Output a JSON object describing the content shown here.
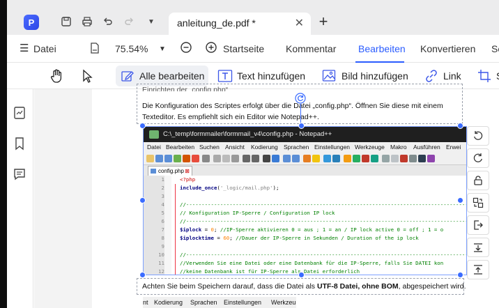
{
  "titlebar": {
    "tab_title": "anleitung_de.pdf *",
    "tab_close": "✕",
    "new_tab": "+"
  },
  "menubar": {
    "file": "Datei",
    "zoom": "75.54%",
    "items": [
      "Startseite",
      "Kommentar",
      "Bearbeiten",
      "Konvertieren",
      "Se"
    ],
    "active": "Bearbeiten"
  },
  "toolbar": {
    "edit_all": "Alle bearbeiten",
    "add_text": "Text hinzufügen",
    "add_image": "Bild hinzufügen",
    "link": "Link",
    "more": "S"
  },
  "document": {
    "heading_partial": "Einrichten der „config.php“",
    "para1_line1": "Die Konfiguration des Scriptes erfolgt über die Datei „config.php“. Öffnen Sie diese mit einem",
    "para1_line2": "Texteditor. Es empfiehlt sich ein Editor wie Notepad++.",
    "para2_prefix": "Achten Sie beim Speichern darauf, dass die Datei als ",
    "para2_bold": "UTF-8 Datei, ohne BOM",
    "para2_suffix": ", abgespeichert wird."
  },
  "notepad": {
    "title": "C:\\_temp\\formmailer\\formmail_v4\\config.php - Notepad++",
    "menu": [
      "Datei",
      "Bearbeiten",
      "Suchen",
      "Ansicht",
      "Kodierung",
      "Sprachen",
      "Einstellungen",
      "Werkzeuge",
      "Makro",
      "Ausführen",
      "Erwei"
    ],
    "tab": "config.php",
    "lines": [
      {
        "n": "1",
        "t": "<?php"
      },
      {
        "n": "2",
        "t": "include_once('_logic/mail.php');"
      },
      {
        "n": "3",
        "t": ""
      },
      {
        "n": "4",
        "t": "//--------------------------------------------------------------------------------------------"
      },
      {
        "n": "5",
        "t": "// Konfiguration IP-Sperre / Configuration IP lock"
      },
      {
        "n": "6",
        "t": "//--------------------------------------------------------------------------------------------"
      },
      {
        "n": "7",
        "t": "$iplock = 0;  //IP-Sperre aktivieren 0 = aus ; 1 = an / IP lock active 0 = off ; 1 = o"
      },
      {
        "n": "8",
        "t": "$iplocktime = 60; //Dauer der IP-Sperre in Sekunden / Duration of the ip lock"
      },
      {
        "n": "9",
        "t": ""
      },
      {
        "n": "10",
        "t": "//--------------------------------------------------------------------------------------------"
      },
      {
        "n": "11",
        "t": "//Verwenden Sie eine Datei oder eine Datenbank für die IP-Sperre, falls Sie DATEI kon"
      },
      {
        "n": "12",
        "t": "//keine Datenbank ist für IP-Sperre als Datei erforderlich"
      }
    ]
  },
  "bottom_strip": [
    "nt",
    "Kodierung",
    "Sprachen",
    "Einstellungen",
    "Werkzeu"
  ]
}
